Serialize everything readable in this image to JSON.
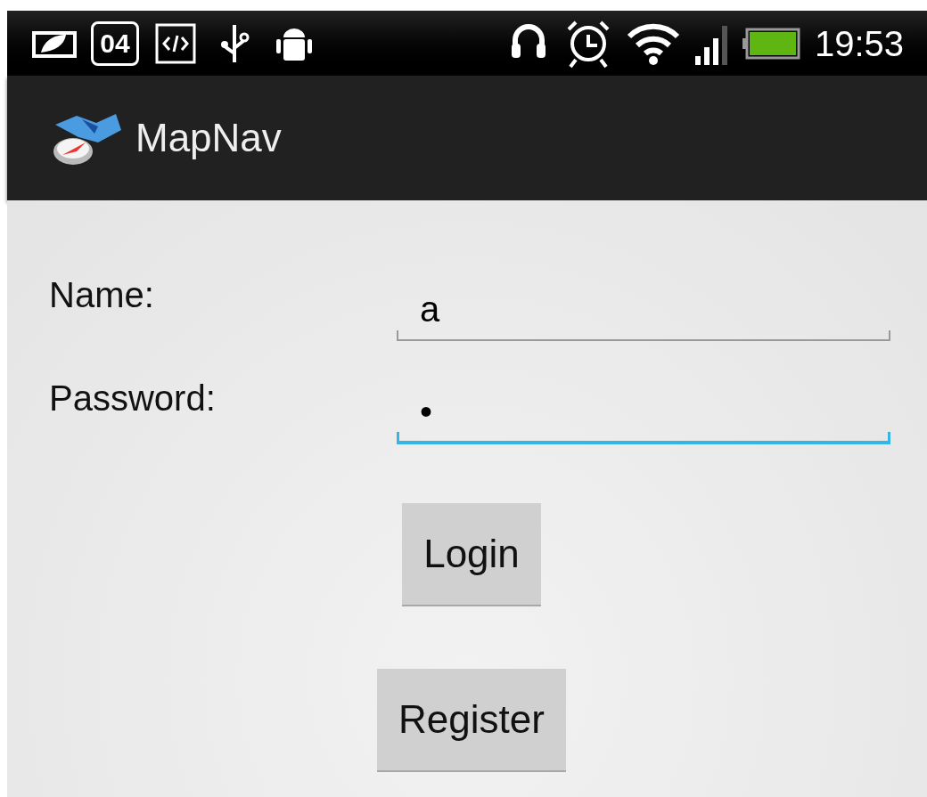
{
  "status_bar": {
    "calendar_day": "04",
    "time": "19:53"
  },
  "app_bar": {
    "title": "MapNav"
  },
  "form": {
    "fields": [
      {
        "label": "Name:",
        "value": "a",
        "focused": false
      },
      {
        "label": "Password:",
        "value": "•",
        "focused": true
      }
    ],
    "buttons": [
      {
        "label": "Login"
      },
      {
        "label": "Register"
      }
    ]
  }
}
